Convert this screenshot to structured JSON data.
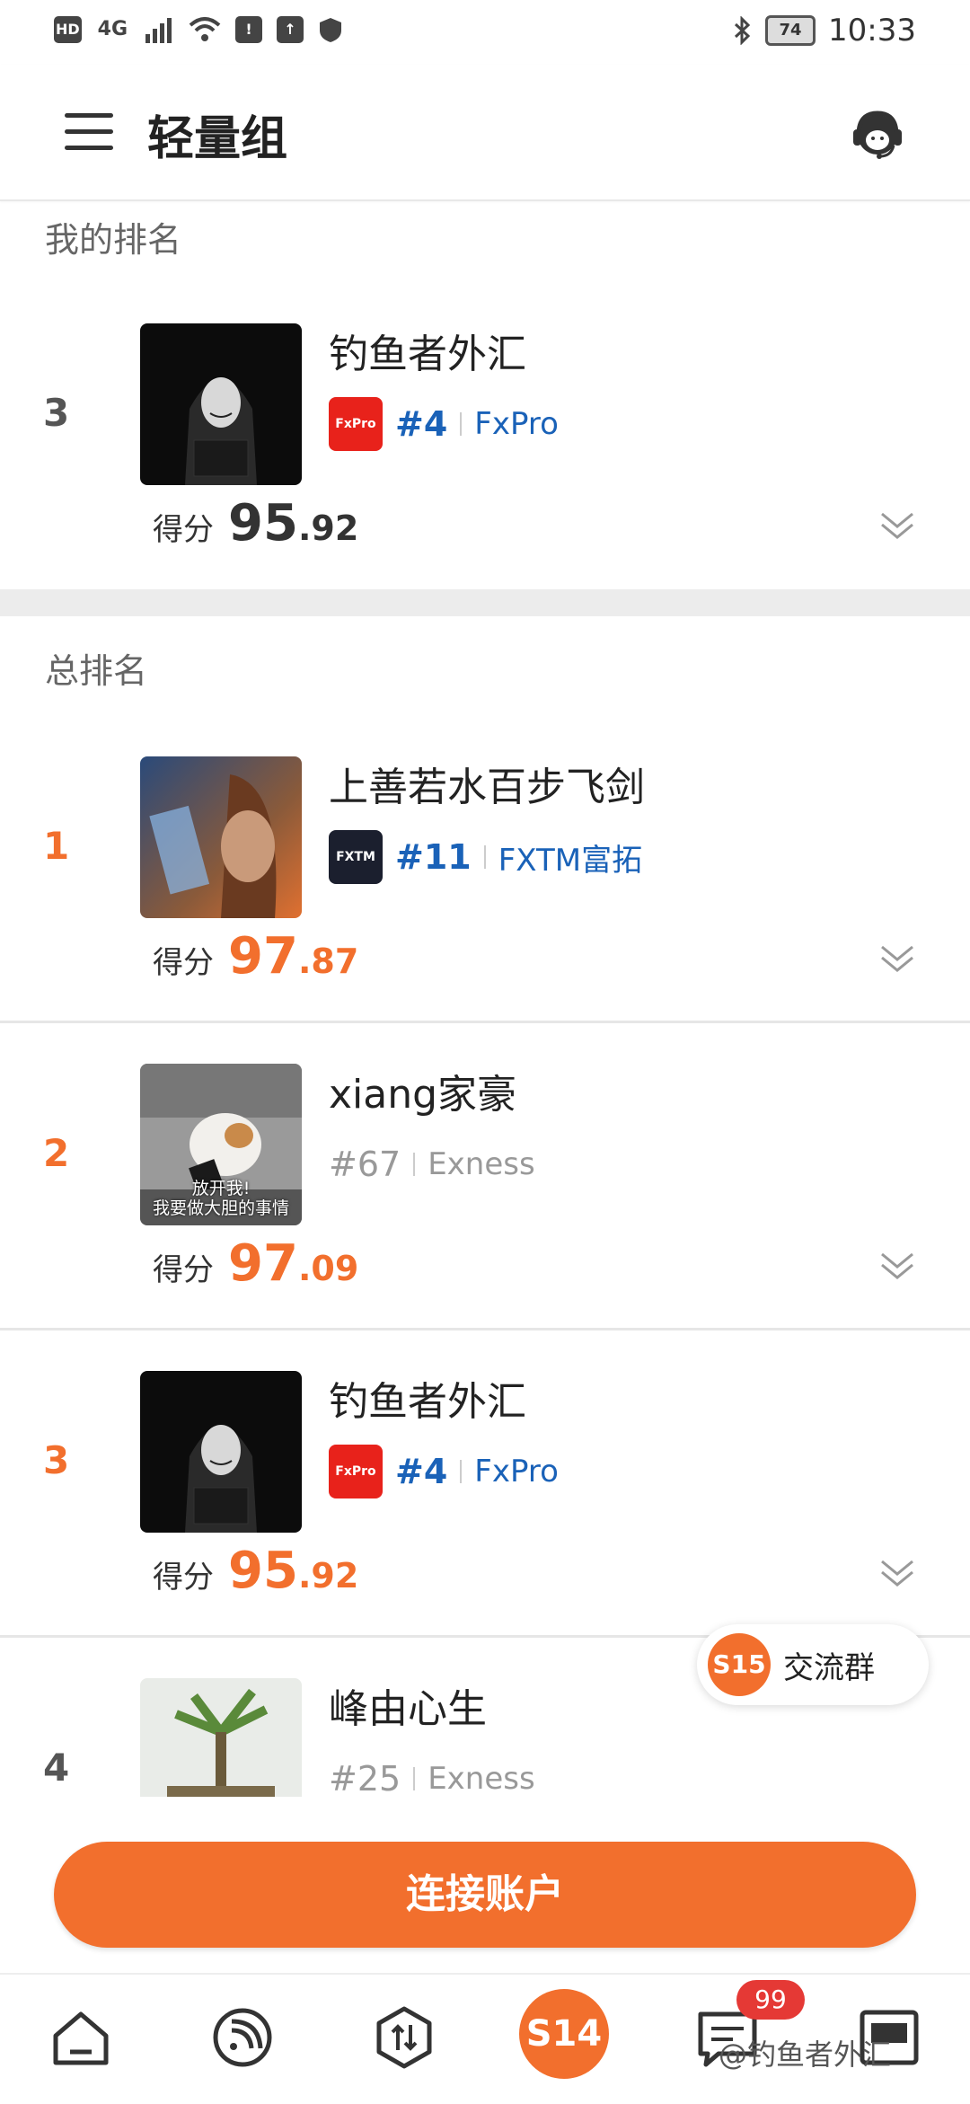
{
  "status_bar": {
    "left_icons": [
      "HD",
      "4G",
      "signal-icon",
      "wifi-icon",
      "!",
      "upload-icon",
      "shield-icon"
    ],
    "hd": "HD",
    "net": "4G",
    "battery": "74",
    "time": "10:33"
  },
  "header": {
    "title": "轻量组"
  },
  "my_rank": {
    "label": "我的排名",
    "entry": {
      "rank": "3",
      "name": "钓鱼者外汇",
      "broker_rank": "#4",
      "broker_name": "FxPro",
      "broker_logo": "FxPro",
      "score_label": "得分",
      "score_int": "95",
      "score_dec": ".92"
    }
  },
  "overall": {
    "label": "总排名",
    "entries": [
      {
        "rank": "1",
        "name": "上善若水百步飞剑",
        "broker_rank": "#11",
        "broker_name": "FXTM富拓",
        "broker_logo": "FXTM",
        "score_label": "得分",
        "score_int": "97",
        "score_dec": ".87"
      },
      {
        "rank": "2",
        "name": "xiang家豪",
        "broker_rank": "#67",
        "broker_name": "Exness",
        "score_label": "得分",
        "score_int": "97",
        "score_dec": ".09",
        "avatar_caption_1": "放开我!",
        "avatar_caption_2": "我要做大胆的事情"
      },
      {
        "rank": "3",
        "name": "钓鱼者外汇",
        "broker_rank": "#4",
        "broker_name": "FxPro",
        "broker_logo": "FxPro",
        "score_label": "得分",
        "score_int": "95",
        "score_dec": ".92"
      },
      {
        "rank": "4",
        "name": "峰由心生",
        "broker_rank": "#25",
        "broker_name": "Exness"
      }
    ]
  },
  "chat": {
    "badge": "S15",
    "label": "交流群"
  },
  "connect_button": "连接账户",
  "tabbar": {
    "center_label": "S14",
    "badge": "99",
    "watermark": "@钓鱼者外汇"
  },
  "colors": {
    "accent": "#f26f2d",
    "link": "#1a62b8"
  }
}
